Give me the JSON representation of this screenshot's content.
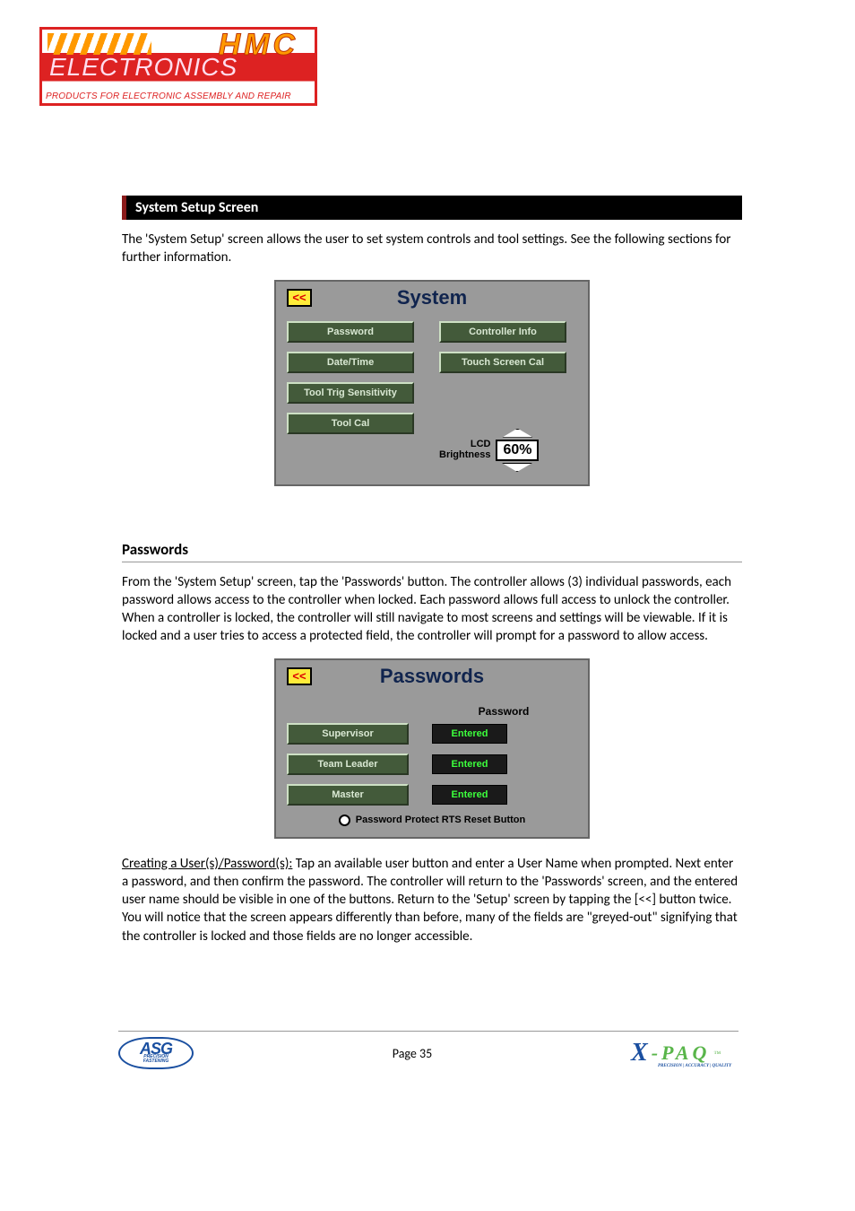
{
  "logo": {
    "hmc": "HMC",
    "elec": "ELECTRONICS",
    "tag": "PRODUCTS FOR ELECTRONIC ASSEMBLY AND REPAIR"
  },
  "section_bar": "System Setup Screen",
  "intro_para": "The 'System Setup' screen allows the user to set system controls and tool settings.  See the following sections for further information.",
  "system_screen": {
    "back": "<<",
    "title": "System",
    "buttons": {
      "password": "Password",
      "controller_info": "Controller Info",
      "date_time": "Date/Time",
      "touch_cal": "Touch Screen Cal",
      "trig_sens": "Tool Trig Sensitivity",
      "tool_cal": "Tool Cal"
    },
    "lcd_label_1": "LCD",
    "lcd_label_2": "Brightness",
    "lcd_value": "60%"
  },
  "passwords_heading": "Passwords",
  "passwords_para": "From the 'System Setup' screen, tap the 'Passwords' button.  The controller allows (3) individual passwords, each password allows access to the controller when locked.  Each password allows full access to unlock the controller.  When a controller is locked, the controller will still navigate to most screens and settings will be viewable.  If it is locked and a user tries to access a protected field, the controller will prompt for a password to allow access.",
  "passwords_screen": {
    "back": "<<",
    "title": "Passwords",
    "col_label": "Password",
    "rows": [
      {
        "role": "Supervisor",
        "status": "Entered"
      },
      {
        "role": "Team Leader",
        "status": "Entered"
      },
      {
        "role": "Master",
        "status": "Entered"
      }
    ],
    "radio_label": "Password Protect RTS Reset Button"
  },
  "creating_para_lead": "Creating a User(s)/Password(s):",
  "creating_para_body": "  Tap an available user button and enter a User Name when prompted.  Next enter a password, and then confirm the password.  The controller will return to the 'Passwords' screen, and the entered user name should be visible in one of the buttons.  Return to the 'Setup' screen by tapping the [<<] button twice.   You will notice that the screen appears differently than before, many of the fields are \"greyed-out\" signifying that the controller is locked and those fields are no longer accessible.",
  "footer": {
    "asg_top": "ASG",
    "asg_sub1": "PRECISION",
    "asg_sub2": "FASTENING",
    "page": "Page 35",
    "x": "X",
    "paq": "-PAQ",
    "tm": "™",
    "xpaq_sub": "PRECISION | ACCURACY | QUALITY"
  }
}
